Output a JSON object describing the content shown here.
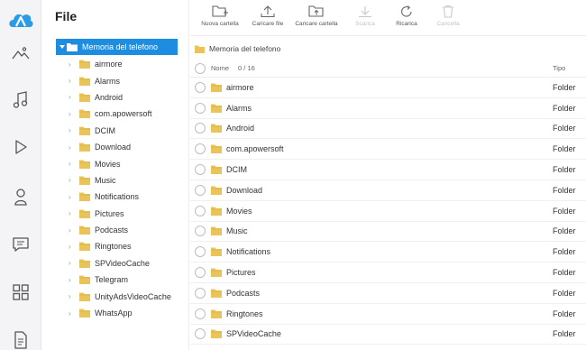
{
  "app": {
    "title": "File"
  },
  "rail": {
    "items": [
      {
        "name": "photos-icon"
      },
      {
        "name": "music-icon"
      },
      {
        "name": "video-icon"
      },
      {
        "name": "contacts-icon"
      },
      {
        "name": "messages-icon"
      },
      {
        "name": "apps-icon"
      },
      {
        "name": "files-icon"
      }
    ]
  },
  "colors": {
    "accent": "#1c8de0",
    "folder": "#e8c45a"
  },
  "tree": {
    "root_label": "Memoria del telefono",
    "items": [
      {
        "label": "airmore"
      },
      {
        "label": "Alarms"
      },
      {
        "label": "Android"
      },
      {
        "label": "com.apowersoft"
      },
      {
        "label": "DCIM"
      },
      {
        "label": "Download"
      },
      {
        "label": "Movies"
      },
      {
        "label": "Music"
      },
      {
        "label": "Notifications"
      },
      {
        "label": "Pictures"
      },
      {
        "label": "Podcasts"
      },
      {
        "label": "Ringtones"
      },
      {
        "label": "SPVideoCache"
      },
      {
        "label": "Telegram"
      },
      {
        "label": "UnityAdsVideoCache"
      },
      {
        "label": "WhatsApp"
      }
    ]
  },
  "toolbar": {
    "new_folder": "Nuova cartella",
    "upload_file": "Caricare file",
    "upload_folder": "Caricare cartella",
    "download": "Scarica",
    "refresh": "Ricarica",
    "delete": "Cancella"
  },
  "breadcrumb": {
    "label": "Memoria del telefono"
  },
  "table": {
    "col_name": "Nome",
    "selection": "0 / 16",
    "col_type": "Tipo",
    "rows": [
      {
        "name": "airmore",
        "type": "Folder"
      },
      {
        "name": "Alarms",
        "type": "Folder"
      },
      {
        "name": "Android",
        "type": "Folder"
      },
      {
        "name": "com.apowersoft",
        "type": "Folder"
      },
      {
        "name": "DCIM",
        "type": "Folder"
      },
      {
        "name": "Download",
        "type": "Folder"
      },
      {
        "name": "Movies",
        "type": "Folder"
      },
      {
        "name": "Music",
        "type": "Folder"
      },
      {
        "name": "Notifications",
        "type": "Folder"
      },
      {
        "name": "Pictures",
        "type": "Folder"
      },
      {
        "name": "Podcasts",
        "type": "Folder"
      },
      {
        "name": "Ringtones",
        "type": "Folder"
      },
      {
        "name": "SPVideoCache",
        "type": "Folder"
      }
    ]
  }
}
